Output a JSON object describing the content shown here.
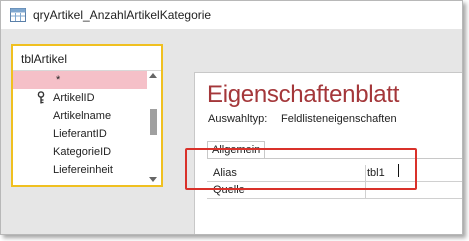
{
  "window": {
    "title": "qryArtikel_AnzahlArtikelKategorie",
    "icon": "query-icon"
  },
  "table": {
    "name": "tblArtikel",
    "fields": [
      "*",
      "ArtikelID",
      "Artikelname",
      "LieferantID",
      "KategorieID",
      "Liefereinheit"
    ],
    "key_field_index": 1,
    "key_icon": "key-icon",
    "scrollbar": {
      "up_icon": "scroll-up-icon",
      "down_icon": "scroll-down-icon"
    }
  },
  "property_sheet": {
    "title": "Eigenschaftenblatt",
    "selection_type_label": "Auswahltyp:",
    "selection_type_value": "Feldlisteneigenschaften",
    "tabs": [
      "Allgemein"
    ],
    "rows": [
      {
        "label": "Alias",
        "value": "tbl1"
      },
      {
        "label": "Quelle",
        "value": ""
      }
    ]
  },
  "colors": {
    "accent_title": "#a4373a",
    "highlight_border": "#d9312a",
    "table_border": "#f0c020",
    "selected_row": "#f5c0c8"
  }
}
